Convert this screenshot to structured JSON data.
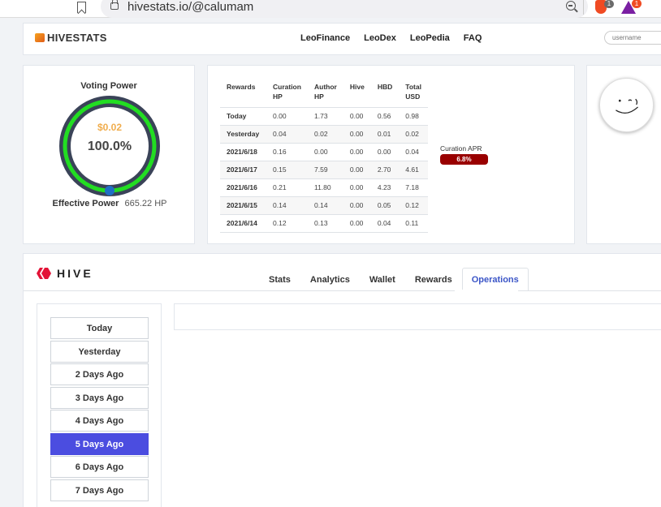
{
  "browser": {
    "url": "hivestats.io/@calumam",
    "brave_badge": "1",
    "rewards_badge": "1"
  },
  "header": {
    "brand": "HIVESTATS",
    "nav": [
      "LeoFinance",
      "LeoDex",
      "LeoPedia",
      "FAQ"
    ],
    "username_placeholder": "username"
  },
  "voting_power": {
    "title": "Voting Power",
    "vote_value": "$0.02",
    "percent": "100.0%",
    "percent_value": 100,
    "effective_label": "Effective Power",
    "effective_value": "665.22 HP",
    "colors": {
      "ring": "#3a4358",
      "fill": "#22dd22",
      "knob": "#1f6fc5"
    }
  },
  "rewards": {
    "headers": [
      "Rewards",
      "Curation HP",
      "Author HP",
      "Hive",
      "HBD",
      "Total USD"
    ],
    "rows": [
      [
        "Today",
        "0.00",
        "1.73",
        "0.00",
        "0.56",
        "0.98"
      ],
      [
        "Yesterday",
        "0.04",
        "0.02",
        "0.00",
        "0.01",
        "0.02"
      ],
      [
        "2021/6/18",
        "0.16",
        "0.00",
        "0.00",
        "0.00",
        "0.04"
      ],
      [
        "2021/6/17",
        "0.15",
        "7.59",
        "0.00",
        "2.70",
        "4.61"
      ],
      [
        "2021/6/16",
        "0.21",
        "11.80",
        "0.00",
        "4.23",
        "7.18"
      ],
      [
        "2021/6/15",
        "0.14",
        "0.14",
        "0.00",
        "0.05",
        "0.12"
      ],
      [
        "2021/6/14",
        "0.12",
        "0.13",
        "0.00",
        "0.04",
        "0.11"
      ]
    ],
    "curation_apr_label": "Curation APR",
    "curation_apr": "6.8%"
  },
  "hive": {
    "logo_text": "HIVE",
    "tabs": [
      "Stats",
      "Analytics",
      "Wallet",
      "Rewards",
      "Operations"
    ],
    "active_tab": "Operations",
    "days": [
      "Today",
      "Yesterday",
      "2 Days Ago",
      "3 Days Ago",
      "4 Days Ago",
      "5 Days Ago",
      "6 Days Ago",
      "7 Days Ago"
    ],
    "active_day": "5 Days Ago"
  }
}
